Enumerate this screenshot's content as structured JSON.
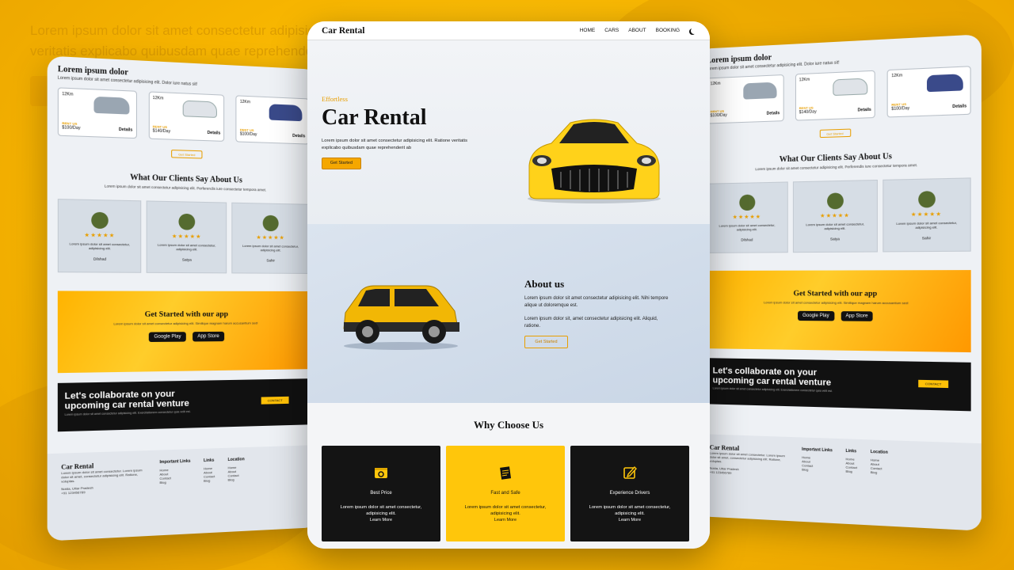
{
  "background": {
    "headline_line1": "Lorem ipsum dolor sit amet consectetur adipisicing elit.",
    "headline_line2": "veritatis explicabo quibusdam quae reprehenderit"
  },
  "colors": {
    "accent": "#f5a700",
    "dark": "#141414",
    "bg": "#f7b500"
  },
  "main": {
    "nav": {
      "logo": "Car Rental",
      "items": [
        "HOME",
        "CARS",
        "ABOUT",
        "BOOKING"
      ],
      "theme_icon": "moon-icon"
    },
    "hero": {
      "eyebrow": "Effortless",
      "title": "Car Rental",
      "text": "Lorem ipsum dolor sit amet consectetur adipisicing elit. Ratione veritatis explicabo quibusdam quae reprehenderit ab",
      "button": "Get Started"
    },
    "about": {
      "title": "About us",
      "p1": "Lorem ipsum dolor sit amet consectetur adipisicing elit. Nihi tempore alique ut doloremque est.",
      "p2": "Lorem ipsum dolor sit, amet consectetur adipisicing elit. Aliquid, ratione.",
      "button": "Get Started"
    },
    "why": {
      "title": "Why Choose Us",
      "cards": [
        {
          "title": "Best Price",
          "text": "Lorem ipsum dolor sit amet consectetur, adipisicing elit.",
          "link": "Learn More",
          "icon": "wallet-icon"
        },
        {
          "title": "Fast and Safe",
          "text": "Lorem ipsum dolor sit amet consectetur, adipisicing elit.",
          "link": "Learn More",
          "icon": "notepad-icon"
        },
        {
          "title": "Experience Drivers",
          "text": "Lorem ipsum dolor sit amet consectetur, adipisicing elit.",
          "link": "Learn More",
          "icon": "edit-icon"
        }
      ]
    }
  },
  "side": {
    "cars_title": "Lorem ipsum dolor",
    "cars_sub": "Lorem ipsum dolor sit amet consectetur adipisicing elit. Dolor iure natus sit!",
    "cars": [
      {
        "km": "12Km",
        "price": "$100/Day",
        "details": "Details"
      },
      {
        "km": "12Km",
        "price": "$140/Day",
        "details": "Details"
      },
      {
        "km": "12Km",
        "price": "$100/Day",
        "details": "Details"
      }
    ],
    "price_tag": "RENT US",
    "get_started": "Get Started",
    "clients_title": "What Our Clients Say About Us",
    "clients_sub": "Lorem ipsum dolor sit amet consectetur adipisicing elit. Perferendis iure consectetur tempora amet.",
    "testimonials": [
      {
        "name": "Dilshad",
        "stars": "★★★★★",
        "text": "Lorem ipsum dolor sit amet consectetur, adipisicing elit."
      },
      {
        "name": "Satya",
        "stars": "★★★★★",
        "text": "Lorem ipsum dolor sit amet consectetur, adipisicing elit."
      },
      {
        "name": "Sahir",
        "stars": "★★★★★",
        "text": "Lorem ipsum dolor sit amet consectetur, adipisicing elit."
      }
    ],
    "app_title": "Get Started with our app",
    "app_sub": "Lorem ipsum dolor sit amet consectetur adipisicing elit. Similique magnam harum accusantium sed!",
    "google_play": "Google Play",
    "app_store": "App Store",
    "collab_title": "Let's collaborate on your upcoming car rental venture",
    "collab_sub": "Lorem ipsum dolor sit amet consectetur adipisicing elit. Exercitationem consectetur quia velit est.",
    "contact": "CONTACT",
    "footer": {
      "brand": "Car Rental",
      "brand_text": "Lorem ipsum dolor sit amet consectetur. Lorem ipsum dolor sit amet, consectetur adipisicing elit. Ratione, voluptas.",
      "address": "Noida, Uttar Pradesh",
      "phone": "+91 123456789",
      "cols": [
        {
          "title": "Important Links",
          "links": [
            "Home",
            "About",
            "Contact",
            "Blog"
          ]
        },
        {
          "title": "Links",
          "links": [
            "Home",
            "About",
            "Contact",
            "Blog"
          ]
        },
        {
          "title": "Location",
          "links": [
            "Home",
            "About",
            "Contact",
            "Blog"
          ]
        }
      ]
    }
  }
}
